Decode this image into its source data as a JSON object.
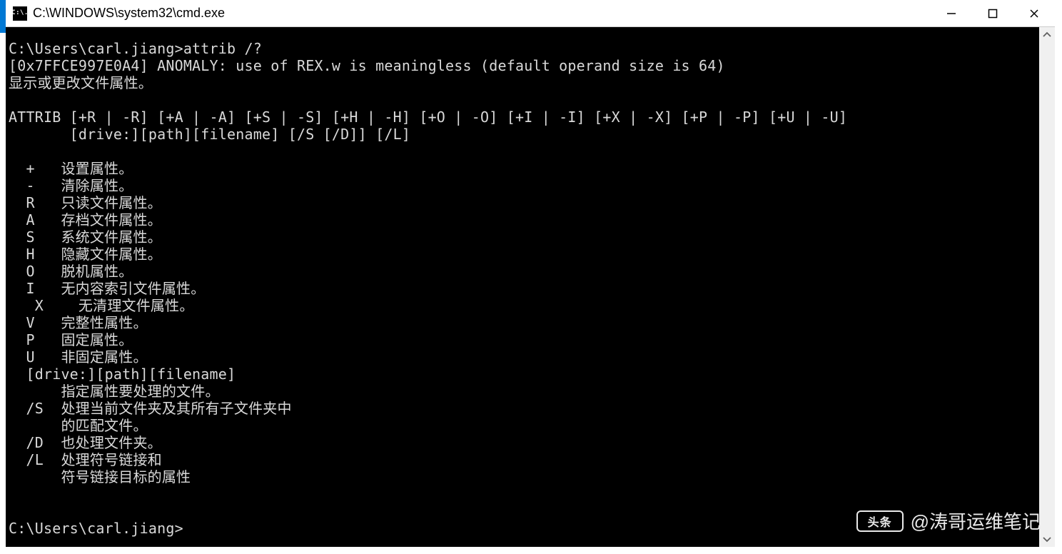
{
  "window": {
    "title": "C:\\WINDOWS\\system32\\cmd.exe",
    "icon_label": "C:\\."
  },
  "terminal": {
    "prompt1": "C:\\Users\\carl.jiang>attrib /?",
    "anomaly": "[0x7FFCE997E0A4] ANOMALY: use of REX.w is meaningless (default operand size is 64)",
    "heading": "显示或更改文件属性。",
    "syntax1": "ATTRIB [+R | -R] [+A | -A] [+S | -S] [+H | -H] [+O | -O] [+I | -I] [+X | -X] [+P | -P] [+U | -U]",
    "syntax2": "       [drive:][path][filename] [/S [/D]] [/L]",
    "opt_plus": "  +   设置属性。",
    "opt_minus": "  -   清除属性。",
    "opt_R": "  R   只读文件属性。",
    "opt_A": "  A   存档文件属性。",
    "opt_S": "  S   系统文件属性。",
    "opt_H": "  H   隐藏文件属性。",
    "opt_O": "  O   脱机属性。",
    "opt_I": "  I   无内容索引文件属性。",
    "opt_X": "   X    无清理文件属性。",
    "opt_V": "  V   完整性属性。",
    "opt_P": "  P   固定属性。",
    "opt_U": "  U   非固定属性。",
    "opt_path": "  [drive:][path][filename]",
    "opt_path2": "      指定属性要处理的文件。",
    "opt_Sflag": "  /S  处理当前文件夹及其所有子文件夹中",
    "opt_Sflag2": "      的匹配文件。",
    "opt_Dflag": "  /D  也处理文件夹。",
    "opt_Lflag": "  /L  处理符号链接和",
    "opt_Lflag2": "      符号链接目标的属性",
    "prompt2": "C:\\Users\\carl.jiang>"
  },
  "watermark": {
    "logo_text": "头条",
    "author": "@涛哥运维笔记"
  }
}
